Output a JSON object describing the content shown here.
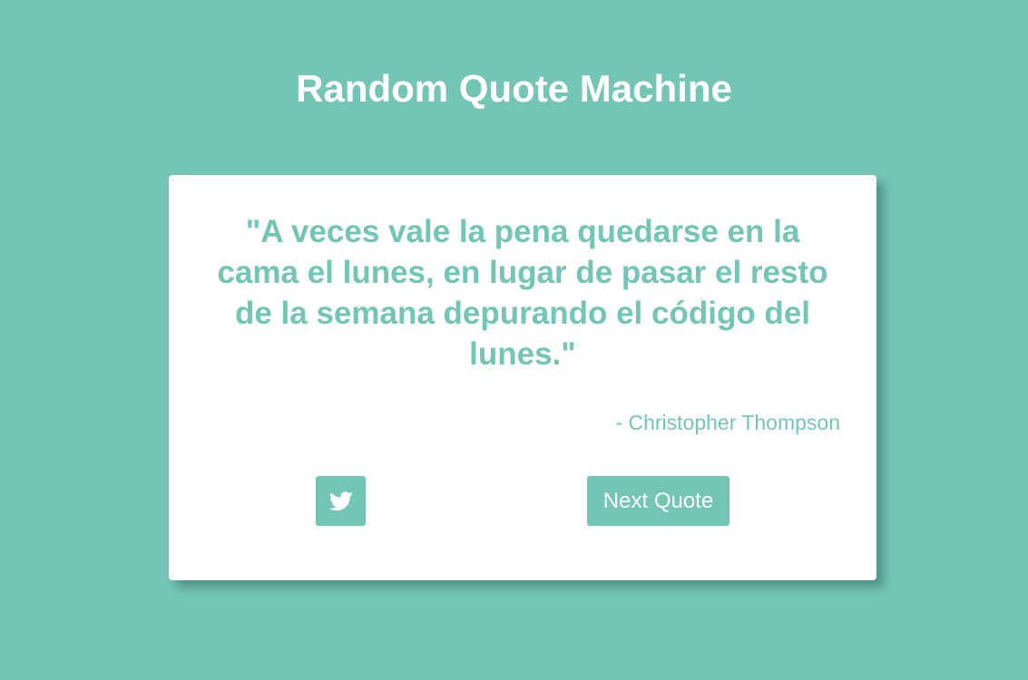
{
  "header": {
    "title": "Random Quote Machine"
  },
  "quote": {
    "text": "\"A veces vale la pena quedarse en la cama el lunes, en lugar de pasar el resto de la semana depurando el código del lunes.\"",
    "author": "- Christopher Thompson"
  },
  "actions": {
    "tweet_icon": "twitter-icon",
    "next_label": "Next Quote"
  },
  "colors": {
    "background": "#73c5b5",
    "card": "#ffffff",
    "accent": "#73c5b5"
  }
}
